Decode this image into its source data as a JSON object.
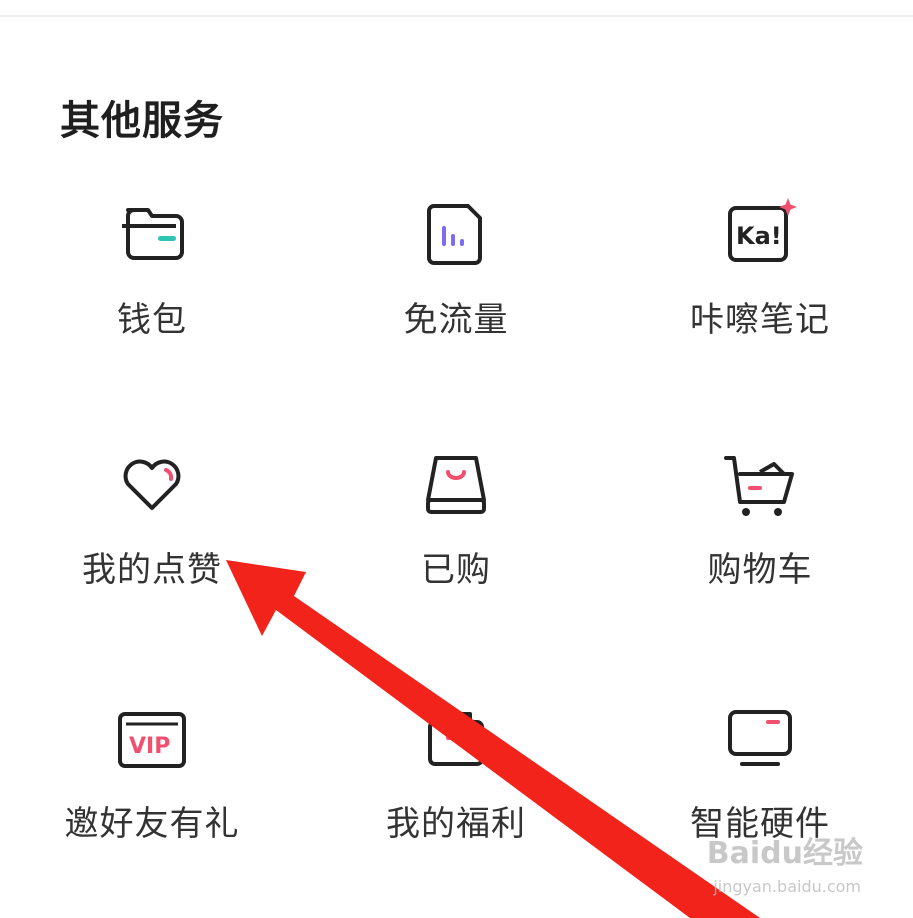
{
  "section": {
    "title": "其他服务"
  },
  "services": [
    {
      "label": "钱包",
      "icon": "wallet-icon"
    },
    {
      "label": "免流量",
      "icon": "data-free-icon"
    },
    {
      "label": "咔嚓笔记",
      "icon": "kacha-notes-icon"
    },
    {
      "label": "我的点赞",
      "icon": "heart-icon"
    },
    {
      "label": "已购",
      "icon": "purchased-bag-icon"
    },
    {
      "label": "购物车",
      "icon": "shopping-cart-icon"
    },
    {
      "label": "邀好友有礼",
      "icon": "vip-ticket-icon"
    },
    {
      "label": "我的福利",
      "icon": "gift-box-icon"
    },
    {
      "label": "智能硬件",
      "icon": "smart-device-icon"
    }
  ],
  "kacha_icon_text": "Ka!",
  "vip_icon_text": "VIP",
  "watermark": {
    "brand": "Baidu经验",
    "url": "jingyan.baidu.com"
  },
  "colors": {
    "accent_pink": "#f0506e",
    "accent_teal": "#2ec5b6",
    "accent_purple": "#7b6cf0",
    "annotation_arrow": "#f2231b",
    "icon_stroke": "#222222"
  }
}
